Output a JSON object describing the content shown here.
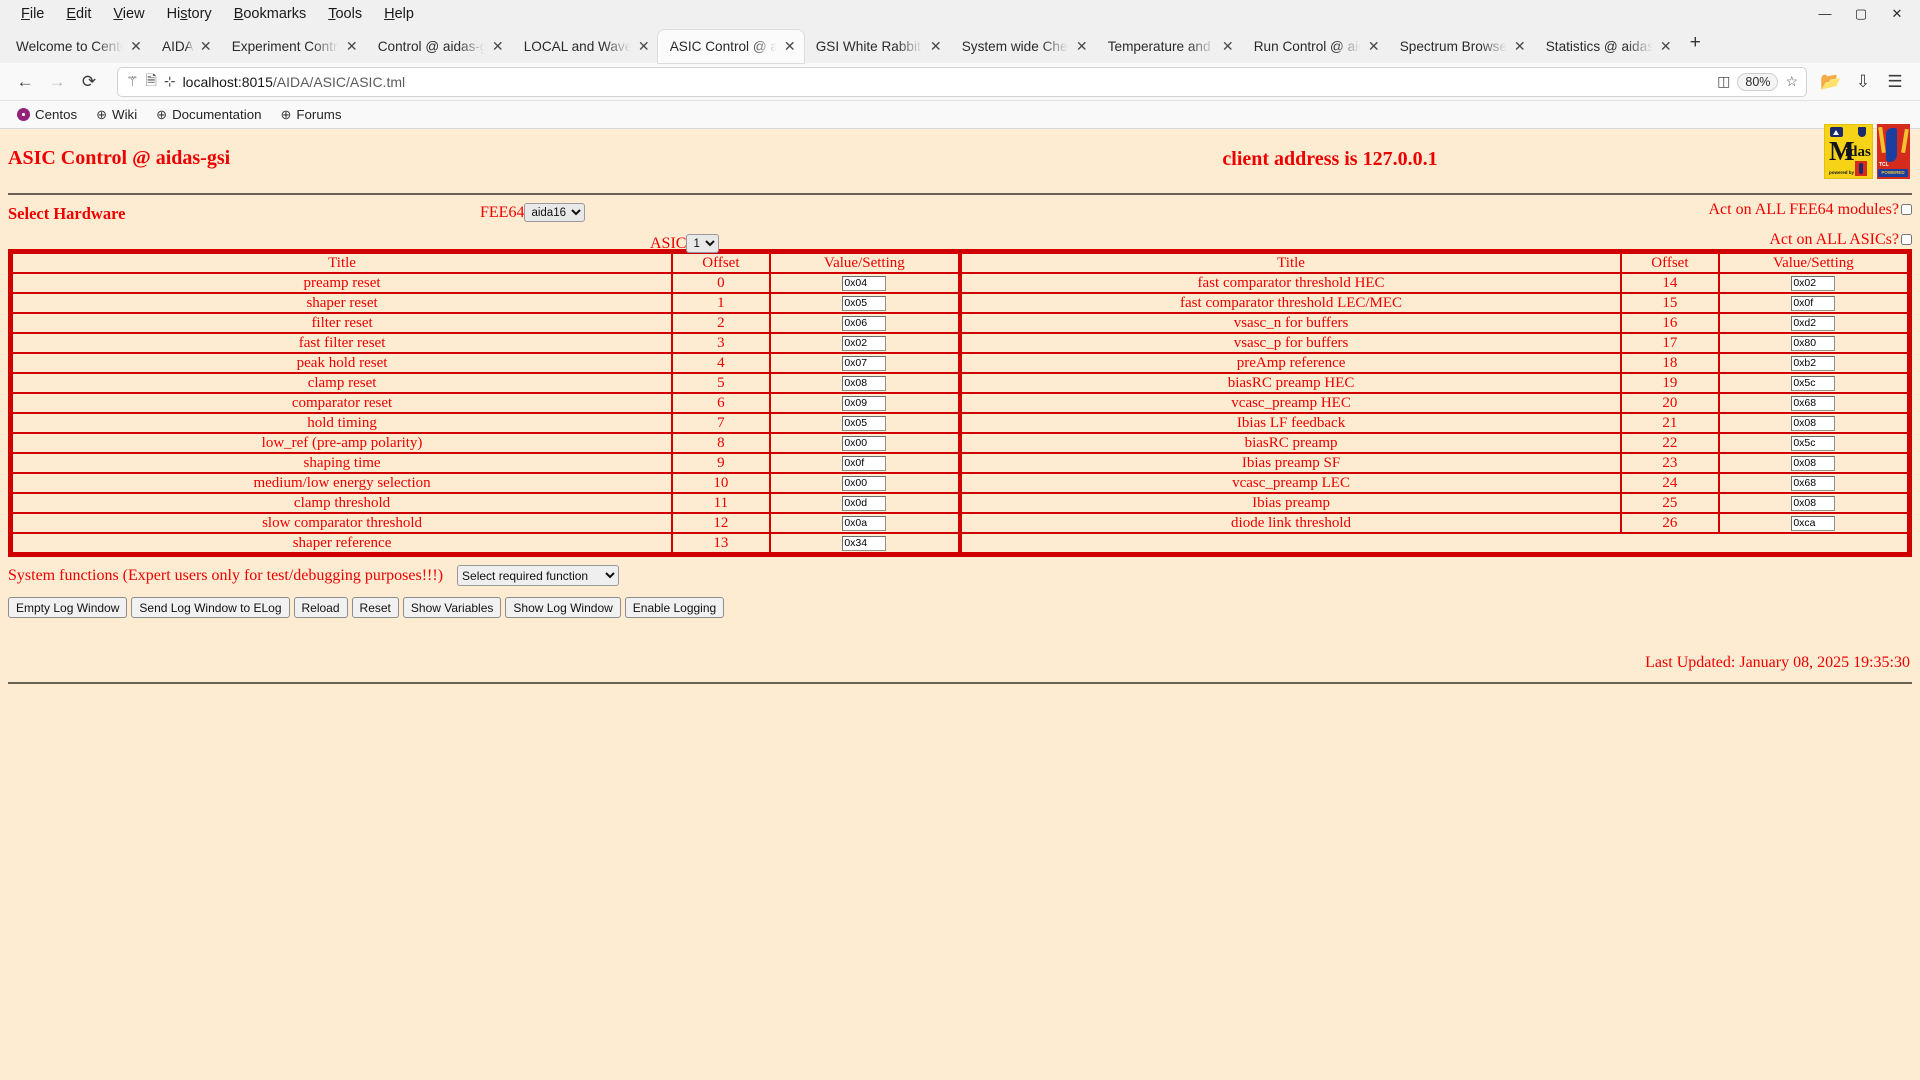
{
  "browser": {
    "menus": [
      "File",
      "Edit",
      "View",
      "History",
      "Bookmarks",
      "Tools",
      "Help"
    ],
    "window_controls": {
      "minimize": "—",
      "maximize": "▢",
      "close": "✕"
    },
    "tabs": [
      {
        "label": "Welcome to CentO",
        "active": false
      },
      {
        "label": "AIDA",
        "active": false
      },
      {
        "label": "Experiment Contro",
        "active": false
      },
      {
        "label": "Control @ aidas-gs",
        "active": false
      },
      {
        "label": "LOCAL and Wavefo",
        "active": false
      },
      {
        "label": "ASIC Control @ aid",
        "active": true
      },
      {
        "label": "GSI White Rabbit T",
        "active": false
      },
      {
        "label": "System wide Check",
        "active": false
      },
      {
        "label": "Temperature and s",
        "active": false
      },
      {
        "label": "Run Control @ aida",
        "active": false
      },
      {
        "label": "Spectrum Browser",
        "active": false
      },
      {
        "label": "Statistics @ aidas",
        "active": false
      }
    ],
    "new_tab_label": "+",
    "nav": {
      "back": "←",
      "forward": "→",
      "reload": "⟳"
    },
    "url": {
      "host": "localhost:8015",
      "path": "/AIDA/ASIC/ASIC.tml"
    },
    "zoom_level": "80%",
    "bookmarks": [
      {
        "label": "Centos",
        "icon": "centos-icon"
      },
      {
        "label": "Wiki",
        "icon": "globe-icon"
      },
      {
        "label": "Documentation",
        "icon": "globe-icon"
      },
      {
        "label": "Forums",
        "icon": "globe-icon"
      }
    ]
  },
  "page": {
    "title": "ASIC Control @ aidas-gsi",
    "client_address": "client address is 127.0.0.1",
    "select_hardware_label": "Select Hardware",
    "fee64": {
      "label": "FEE64",
      "value": "aida16"
    },
    "asic": {
      "label": "ASIC",
      "value": "1"
    },
    "act_all_fee64": "Act on ALL FEE64 modules?",
    "act_all_asics": "Act on ALL ASICs?",
    "columns": {
      "title": "Title",
      "offset": "Offset",
      "value": "Value/Setting"
    },
    "rows_left": [
      {
        "title": "preamp reset",
        "offset": "0",
        "value": "0x04"
      },
      {
        "title": "shaper reset",
        "offset": "1",
        "value": "0x05"
      },
      {
        "title": "filter reset",
        "offset": "2",
        "value": "0x06"
      },
      {
        "title": "fast filter reset",
        "offset": "3",
        "value": "0x02"
      },
      {
        "title": "peak hold reset",
        "offset": "4",
        "value": "0x07"
      },
      {
        "title": "clamp reset",
        "offset": "5",
        "value": "0x08"
      },
      {
        "title": "comparator reset",
        "offset": "6",
        "value": "0x09"
      },
      {
        "title": "hold timing",
        "offset": "7",
        "value": "0x05"
      },
      {
        "title": "low_ref (pre-amp polarity)",
        "offset": "8",
        "value": "0x00"
      },
      {
        "title": "shaping time",
        "offset": "9",
        "value": "0x0f"
      },
      {
        "title": "medium/low energy selection",
        "offset": "10",
        "value": "0x00"
      },
      {
        "title": "clamp threshold",
        "offset": "11",
        "value": "0x0d"
      },
      {
        "title": "slow comparator threshold",
        "offset": "12",
        "value": "0x0a"
      },
      {
        "title": "shaper reference",
        "offset": "13",
        "value": "0x34"
      }
    ],
    "rows_right": [
      {
        "title": "fast comparator threshold HEC",
        "offset": "14",
        "value": "0x02"
      },
      {
        "title": "fast comparator threshold LEC/MEC",
        "offset": "15",
        "value": "0x0f"
      },
      {
        "title": "vsasc_n for buffers",
        "offset": "16",
        "value": "0xd2"
      },
      {
        "title": "vsasc_p for buffers",
        "offset": "17",
        "value": "0x80"
      },
      {
        "title": "preAmp reference",
        "offset": "18",
        "value": "0xb2"
      },
      {
        "title": "biasRC preamp HEC",
        "offset": "19",
        "value": "0x5c"
      },
      {
        "title": "vcasc_preamp HEC",
        "offset": "20",
        "value": "0x68"
      },
      {
        "title": "Ibias LF feedback",
        "offset": "21",
        "value": "0x08"
      },
      {
        "title": "biasRC preamp",
        "offset": "22",
        "value": "0x5c"
      },
      {
        "title": "Ibias preamp SF",
        "offset": "23",
        "value": "0x08"
      },
      {
        "title": "vcasc_preamp LEC",
        "offset": "24",
        "value": "0x68"
      },
      {
        "title": "Ibias preamp",
        "offset": "25",
        "value": "0x08"
      },
      {
        "title": "diode link threshold",
        "offset": "26",
        "value": "0xca"
      }
    ],
    "system_functions_label": "System functions (Expert users only for test/debugging purposes!!!)",
    "system_function_select": "Select required function",
    "buttons": [
      "Empty Log Window",
      "Send Log Window to ELog",
      "Reload",
      "Reset",
      "Show Variables",
      "Show Log Window",
      "Enable Logging"
    ],
    "last_updated": "Last Updated: January 08, 2025 19:35:30"
  },
  "colors": {
    "page_bg": "#fdecd2",
    "accent_red": "#ef0000",
    "border_red": "#d00000"
  }
}
